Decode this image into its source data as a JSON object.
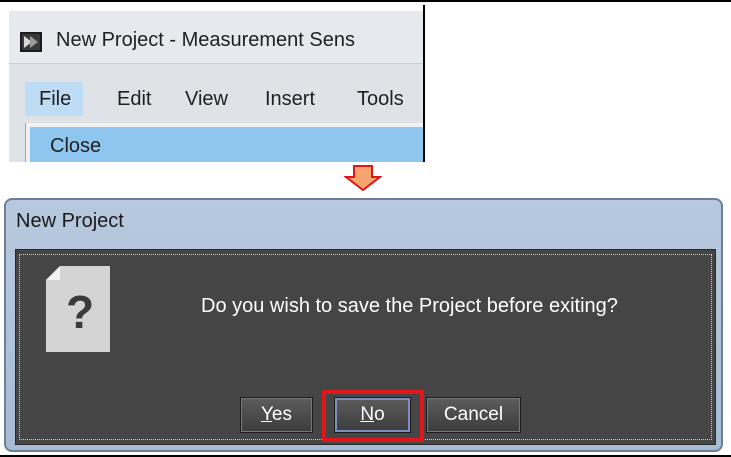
{
  "app_window": {
    "title": "New Project - Measurement Sens",
    "menu": [
      "File",
      "Edit",
      "View",
      "Insert",
      "Tools"
    ],
    "dropdown_item": "Close"
  },
  "dialog": {
    "title": "New Project",
    "message": "Do you wish to save the Project before exiting?",
    "icon": "question-document-icon",
    "buttons": {
      "yes_underline": "Y",
      "yes_rest": "es",
      "no_underline": "N",
      "no_rest": "o",
      "cancel": "Cancel"
    }
  },
  "colors": {
    "highlight": "#e0161b",
    "arrow": "#f5a46e",
    "menu_selected": "#8ec6f0"
  }
}
